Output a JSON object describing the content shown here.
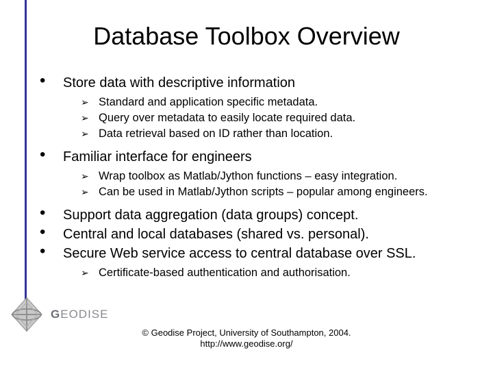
{
  "title": "Database Toolbox Overview",
  "bullets": {
    "b0": {
      "text": "Store data with descriptive information"
    },
    "b0_sub": {
      "s0": "Standard and application specific metadata.",
      "s1": "Query over metadata to easily locate required data.",
      "s2": "Data retrieval based on ID rather than location."
    },
    "b1": {
      "text": "Familiar interface for engineers"
    },
    "b1_sub": {
      "s0": "Wrap toolbox as Matlab/Jython functions – easy integration.",
      "s1": "Can be used in Matlab/Jython scripts – popular among engineers."
    },
    "b2": {
      "text": "Support data aggregation (data groups) concept."
    },
    "b3": {
      "text": "Central and local databases (shared vs. personal)."
    },
    "b4": {
      "text": "Secure Web service access to central database over SSL."
    },
    "b4_sub": {
      "s0": "Certificate-based authentication and authorisation."
    }
  },
  "footer": {
    "line1": "© Geodise Project, University of Southampton, 2004.",
    "line2": "http://www.geodise.org/"
  },
  "logo": {
    "text_head": "G",
    "text_tail": "EODISE"
  },
  "glyphs": {
    "dot": "•",
    "arrow": "➢"
  }
}
